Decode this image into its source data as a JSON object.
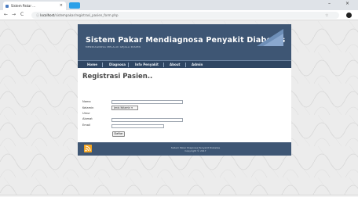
{
  "browser": {
    "tab_title": "Sistem Pakar ...",
    "tab_close": "×",
    "win_minimize": "–",
    "win_close": "×",
    "back": "←",
    "forward": "→",
    "reload": "C",
    "site_info": "ⓘ",
    "url_host": "localhost",
    "url_path": "/sistempakar/registrasi_pasien_form.php",
    "bookmark": "☆"
  },
  "header": {
    "title": "Sistem Pakar Mendiagnosa Penyakit Diabetes",
    "subtitle": "MENDIAGNOSA MELALUI GEJALA PASIEN"
  },
  "nav": {
    "items": [
      "Home",
      "Diagnosa",
      "Info Penyakit",
      "About",
      "Admin"
    ]
  },
  "form": {
    "page_title": "Registrasi Pasien..",
    "labels": [
      "Nama",
      "Kelamin",
      "Umur",
      "Alamat",
      "Email"
    ],
    "gender_selected": "Jenis Kelamin",
    "submit_label": "Daftar"
  },
  "footer": {
    "line1": "Sistem Pakar Diagnosa Penyakit Diabetes",
    "line2": "Copyright © 2017"
  },
  "colors": {
    "header_bg": "#3e5674",
    "nav_bg": "#2f4663",
    "rss": "#f5a623"
  }
}
